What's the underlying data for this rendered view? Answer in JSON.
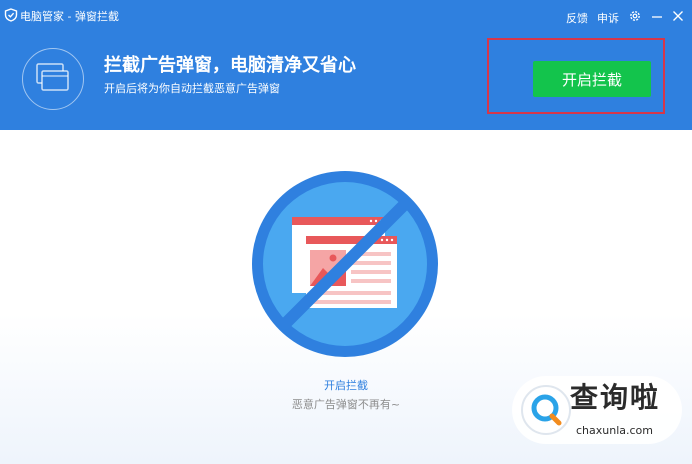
{
  "app": {
    "title": "电脑管家 - 弹窗拦截"
  },
  "titlebar": {
    "feedback_label": "反馈",
    "complaint_label": "申诉"
  },
  "hero": {
    "title": "拦截广告弹窗，电脑清净又省心",
    "subtitle": "开启后将为你自动拦截恶意广告弹窗",
    "action_label": "开启拦截"
  },
  "status": {
    "title": "开启拦截",
    "subtitle": "恶意广告弹窗不再有~"
  },
  "watermark": {
    "text": "查询啦",
    "url": "chaxunla.com"
  },
  "colors": {
    "header_bg": "#2f80df",
    "action_button": "#13c44c",
    "highlight_border": "#d6374a",
    "status_link": "#2f80df",
    "illustration_circle": "#4aa8f0",
    "illustration_ring": "#2f80df",
    "popup_accent": "#e8585a"
  },
  "icons": {
    "app_logo": "shield-icon",
    "settings": "gear-icon",
    "minimize": "minimize-icon",
    "close": "close-icon",
    "hero": "stacked-windows-icon",
    "illustration": "blocked-popup-icon"
  }
}
